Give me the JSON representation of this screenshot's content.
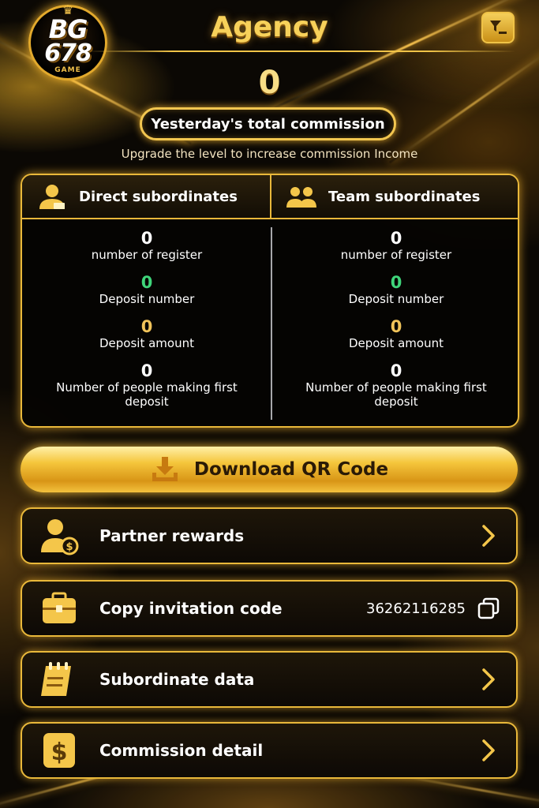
{
  "header": {
    "logo": {
      "line1": "BG",
      "line2": "678",
      "line3": "GAME"
    },
    "title": "Agency"
  },
  "commission": {
    "value": "0",
    "label": "Yesterday's total commission",
    "upgrade_note": "Upgrade the level to increase commission Income"
  },
  "direct": {
    "title": "Direct subordinates",
    "stats": [
      {
        "value": "0",
        "label": "number of register"
      },
      {
        "value": "0",
        "label": "Deposit number"
      },
      {
        "value": "0",
        "label": "Deposit amount"
      },
      {
        "value": "0",
        "label": "Number of people making first deposit"
      }
    ]
  },
  "team": {
    "title": "Team subordinates",
    "stats": [
      {
        "value": "0",
        "label": "number of register"
      },
      {
        "value": "0",
        "label": "Deposit number"
      },
      {
        "value": "0",
        "label": "Deposit amount"
      },
      {
        "value": "0",
        "label": "Number of people making first deposit"
      }
    ]
  },
  "download": {
    "label": "Download QR Code"
  },
  "menu": {
    "partner_rewards": "Partner rewards",
    "copy_invitation": "Copy invitation code",
    "invitation_code": "36262116285",
    "subordinate_data": "Subordinate data",
    "commission_detail": "Commission detail"
  },
  "colors": {
    "gold": "#e9b83a",
    "green": "#3fd57a",
    "background": "#0b0804"
  },
  "icons": [
    "filter-icon",
    "person-icon",
    "team-icon",
    "download-icon",
    "partner-rewards-icon",
    "briefcase-icon",
    "clipboard-icon",
    "dollar-icon",
    "chevron-right-icon",
    "copy-icon"
  ]
}
